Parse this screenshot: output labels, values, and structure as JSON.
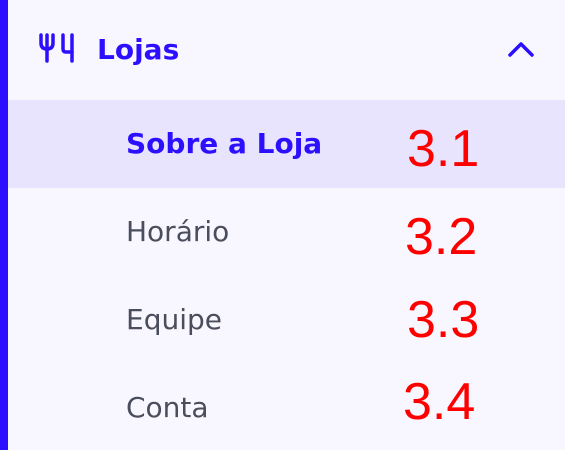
{
  "menu": {
    "group": {
      "label": "Lojas",
      "icon": "restaurant-icon",
      "expand_icon": "chevron-up-icon",
      "expanded": true
    },
    "items": [
      {
        "label": "Sobre a Loja",
        "active": true,
        "annotation": "3.1"
      },
      {
        "label": "Horário",
        "active": false,
        "annotation": "3.2"
      },
      {
        "label": "Equipe",
        "active": false,
        "annotation": "3.3"
      },
      {
        "label": "Conta",
        "active": false,
        "annotation": "3.4"
      }
    ]
  },
  "colors": {
    "accent": "#2d0fff",
    "active_background": "#e8e4fd",
    "menu_background": "#f8f6ff",
    "item_text": "#4a4e5c",
    "annotation": "#ff0000"
  }
}
